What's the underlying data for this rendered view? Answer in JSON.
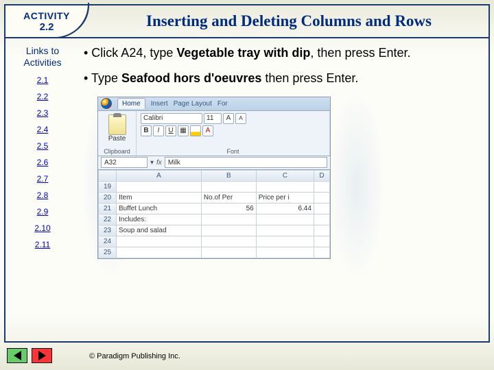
{
  "activity": {
    "label": "ACTIVITY",
    "number": "2.2"
  },
  "title": "Inserting and Deleting Columns and Rows",
  "links": {
    "heading_l1": "Links to",
    "heading_l2": "Activities",
    "items": [
      "2.1",
      "2.2",
      "2.3",
      "2.4",
      "2.5",
      "2.6",
      "2.7",
      "2.8",
      "2.9",
      "2.10",
      "2.11"
    ]
  },
  "bullets": {
    "b1_pre": "• Click A24, type ",
    "b1_bold": "Vegetable tray with dip",
    "b1_post": ", then press Enter.",
    "b2_pre": "• Type ",
    "b2_bold": "Seafood hors d'oeuvres",
    "b2_post": " then press Enter."
  },
  "screenshot": {
    "tabs": {
      "home": "Home",
      "insert": "Insert",
      "pagelayout": "Page Layout",
      "for": "For"
    },
    "groups": {
      "clipboard": "Clipboard",
      "font": "Font"
    },
    "paste_label": "Paste",
    "font_name": "Calibri",
    "font_size": "11",
    "name_box": "A32",
    "fx_label": "fx",
    "formula_val": "Milk",
    "cols": [
      "",
      "A",
      "B",
      "C",
      "D"
    ],
    "rows": [
      {
        "n": "19",
        "a": "",
        "b": "",
        "c": "",
        "d": ""
      },
      {
        "n": "20",
        "a": "Item",
        "b": "No.of Per",
        "c": "Price per i",
        "d": ""
      },
      {
        "n": "21",
        "a": "Buffet Lunch",
        "b": "56",
        "c": "6.44",
        "d": ""
      },
      {
        "n": "22",
        "a": "Includes:",
        "b": "",
        "c": "",
        "d": ""
      },
      {
        "n": "23",
        "a": "Soup and salad",
        "b": "",
        "c": "",
        "d": ""
      },
      {
        "n": "24",
        "a": "",
        "b": "",
        "c": "",
        "d": ""
      },
      {
        "n": "25",
        "a": "",
        "b": "",
        "c": "",
        "d": ""
      }
    ]
  },
  "copyright": "© Paradigm Publishing Inc."
}
